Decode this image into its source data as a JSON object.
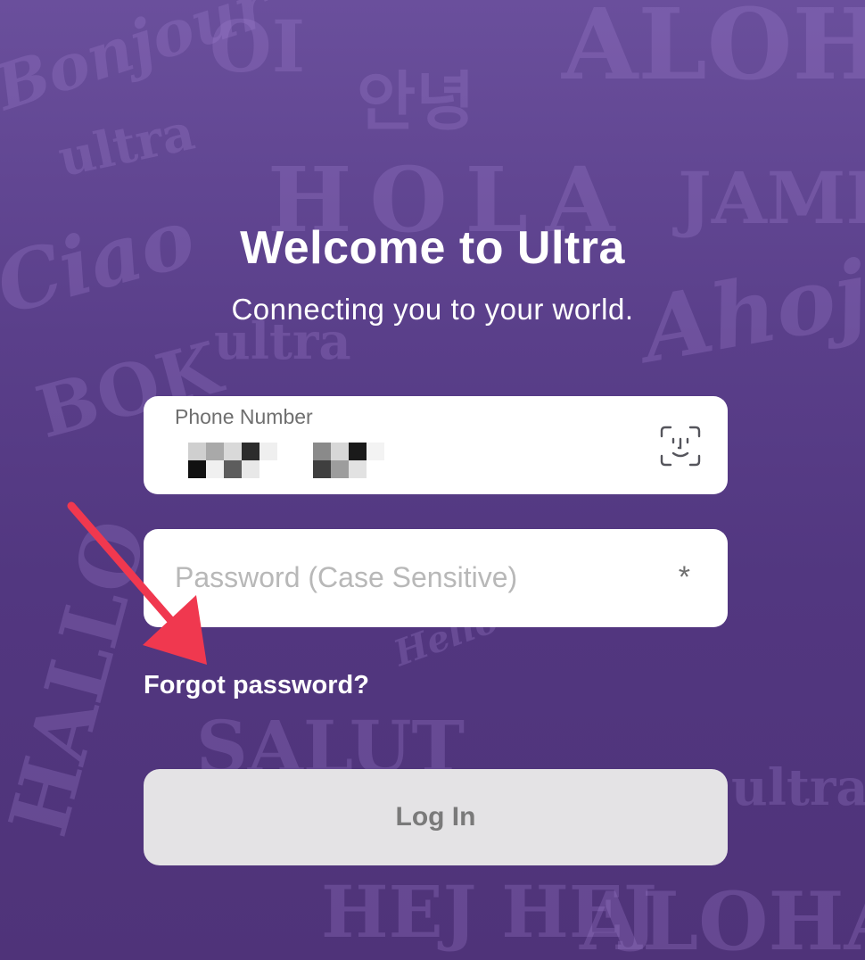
{
  "header": {
    "title": "Welcome to Ultra",
    "subtitle": "Connecting you to your world."
  },
  "phone_field": {
    "label": "Phone Number",
    "value_redacted": true,
    "icon": "face-id-icon"
  },
  "password_field": {
    "placeholder": "Password (Case Sensitive)",
    "icon": "asterisk-icon",
    "icon_glyph": "*"
  },
  "forgot_password": {
    "label": "Forgot password?"
  },
  "login_button": {
    "label": "Log In"
  },
  "annotation": {
    "icon": "red-arrow-icon",
    "color": "#f0384f"
  },
  "colors": {
    "background": "#5a3f8a",
    "field_background": "#ffffff",
    "button_background": "#e4e3e5",
    "button_text": "#7a7a7a"
  },
  "background_words": [
    "Bonjour",
    "OI",
    "안녕",
    "ALOHA",
    "ultra",
    "HOLA",
    "JAMBO",
    "Ciao",
    "Ahoj",
    "BOK",
    "Hello",
    "SALUT",
    "HALLO",
    "HEJ HEJ"
  ]
}
